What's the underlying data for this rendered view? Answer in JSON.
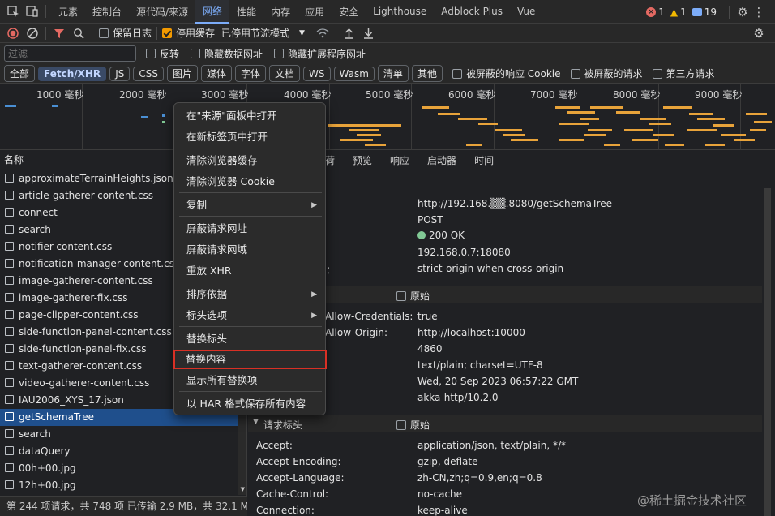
{
  "top_tabs": [
    "元素",
    "控制台",
    "源代码/来源",
    "网络",
    "性能",
    "内存",
    "应用",
    "安全",
    "Lighthouse",
    "Adblock Plus",
    "Vue"
  ],
  "active_tab": "网络",
  "badges": {
    "errors": "1",
    "warnings": "1",
    "messages": "19"
  },
  "toolbar": {
    "preserve_log": "保留日志",
    "disable_cache": "停用缓存",
    "throttle": "已停用节流模式"
  },
  "filter": {
    "placeholder": "过滤",
    "invert": "反转",
    "hide_data_urls": "隐藏数据网址",
    "hide_ext_urls": "隐藏扩展程序网址"
  },
  "type_filters": [
    "全部",
    "Fetch/XHR",
    "JS",
    "CSS",
    "图片",
    "媒体",
    "字体",
    "文档",
    "WS",
    "Wasm",
    "清单",
    "其他"
  ],
  "type_active": "Fetch/XHR",
  "type_checks": [
    "被屏蔽的响应 Cookie",
    "被屏蔽的请求",
    "第三方请求"
  ],
  "timeline_ticks": [
    "1000 毫秒",
    "2000 毫秒",
    "3000 毫秒",
    "4000 毫秒",
    "5000 毫秒",
    "6000 毫秒",
    "7000 毫秒",
    "8000 毫秒",
    "9000 毫秒"
  ],
  "list": {
    "header": "名称",
    "items": [
      "approximateTerrainHeights.json",
      "article-gatherer-content.css",
      "connect",
      "search",
      "notifier-content.css",
      "notification-manager-content.css",
      "image-gatherer-content.css",
      "image-gatherer-fix.css",
      "page-clipper-content.css",
      "side-function-panel-content.css",
      "side-function-panel-fix.css",
      "text-gatherer-content.css",
      "video-gatherer-content.css",
      "IAU2006_XYS_17.json",
      "getSchemaTree",
      "search",
      "dataQuery",
      "00h+00.jpg",
      "12h+00.jpg"
    ],
    "selected": "getSchemaTree"
  },
  "status": "第 244 项请求，共 748 项  已传输 2.9 MB，共 32.1 MB",
  "detail_tabs": [
    "荷",
    "预览",
    "响应",
    "启动器",
    "时间"
  ],
  "general": {
    "url": "http://192.168.▒▒.8080/getSchemaTree",
    "method": "POST",
    "status": "200 OK",
    "remote": "192.168.0.7:18080",
    "policy_label": "策：",
    "policy": "strict-origin-when-cross-origin"
  },
  "response_section": {
    "raw": "原始"
  },
  "response_headers": [
    {
      "k": "Allow-Credentials:",
      "v": "true"
    },
    {
      "k": "Allow-Origin:",
      "v": "http://localhost:10000"
    },
    {
      "k": "",
      "v": "4860"
    },
    {
      "k": "",
      "v": "text/plain; charset=UTF-8"
    },
    {
      "k": "",
      "v": "Wed, 20 Sep 2023 06:57:22 GMT"
    },
    {
      "k": "",
      "v": "akka-http/10.2.0"
    }
  ],
  "request_section": {
    "title": "请求标头",
    "raw": "原始"
  },
  "request_headers": [
    {
      "k": "Accept:",
      "v": "application/json, text/plain, */*"
    },
    {
      "k": "Accept-Encoding:",
      "v": "gzip, deflate"
    },
    {
      "k": "Accept-Language:",
      "v": "zh-CN,zh;q=0.9,en;q=0.8"
    },
    {
      "k": "Cache-Control:",
      "v": "no-cache"
    },
    {
      "k": "Connection:",
      "v": "keep-alive"
    }
  ],
  "context_menu": [
    {
      "label": "在\"来源\"面板中打开",
      "sub": false
    },
    {
      "label": "在新标签页中打开",
      "sub": false
    },
    {
      "label": "清除浏览器缓存",
      "sub": false
    },
    {
      "label": "清除浏览器 Cookie",
      "sub": false
    },
    {
      "label": "复制",
      "sub": true
    },
    {
      "label": "屏蔽请求网址",
      "sub": false
    },
    {
      "label": "屏蔽请求网域",
      "sub": false
    },
    {
      "label": "重放 XHR",
      "sub": false
    },
    {
      "label": "排序依据",
      "sub": true
    },
    {
      "label": "标头选项",
      "sub": true
    },
    {
      "label": "替换标头",
      "sub": false
    },
    {
      "label": "替换内容",
      "sub": false
    },
    {
      "label": "显示所有替换项",
      "sub": false
    },
    {
      "label": "以 HAR 格式保存所有内容",
      "sub": false
    }
  ],
  "highlighted_menu_item": "替换内容",
  "watermark": "@稀土掘金技术社区"
}
